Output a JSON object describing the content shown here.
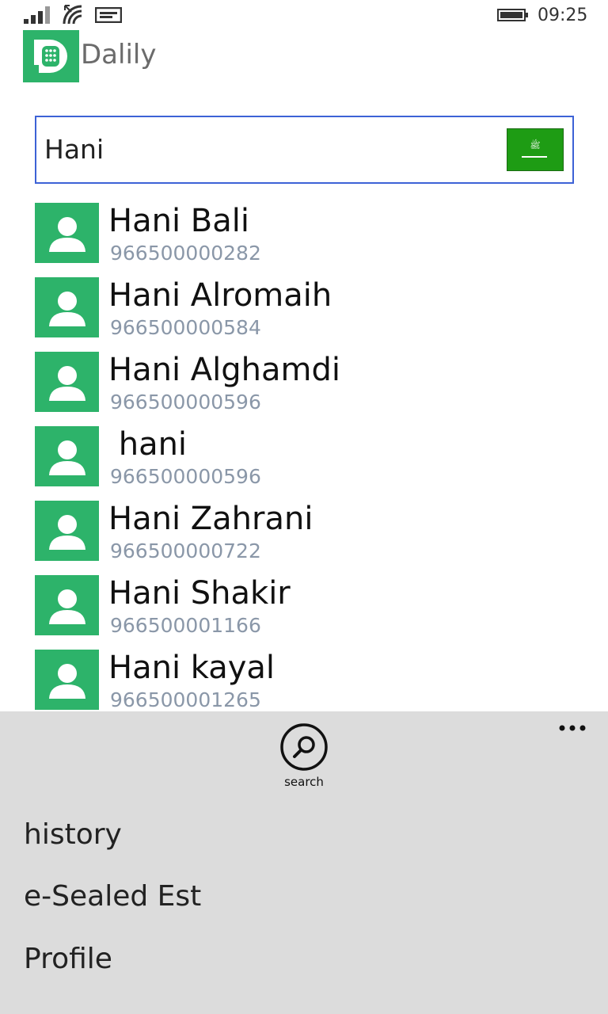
{
  "status_bar": {
    "time": "09:25",
    "icons": [
      "signal-icon",
      "wifi-icon",
      "message-icon",
      "battery-icon"
    ]
  },
  "app": {
    "title": "Dalily",
    "logo_icon": "dalily-logo-icon",
    "accent_color": "#2db36a"
  },
  "search": {
    "value": "Hani",
    "country_flag": "saudi-arabia-flag-icon",
    "border_color": "#3d62d6"
  },
  "contacts": [
    {
      "name": "Hani Bali",
      "phone": "966500000282"
    },
    {
      "name": "Hani Alromaih",
      "phone": "966500000584"
    },
    {
      "name": "Hani Alghamdi",
      "phone": "966500000596"
    },
    {
      "name": " hani",
      "phone": "966500000596"
    },
    {
      "name": "Hani Zahrani",
      "phone": "966500000722"
    },
    {
      "name": "Hani Shakir",
      "phone": "966500001166"
    },
    {
      "name": "Hani kayal",
      "phone": "966500001265"
    }
  ],
  "app_bar": {
    "search_label": "search",
    "more_icon": "more-options-icon",
    "menu_items": [
      "history",
      "e-Sealed Est",
      "Profile"
    ],
    "background": "#dcdcdc"
  }
}
